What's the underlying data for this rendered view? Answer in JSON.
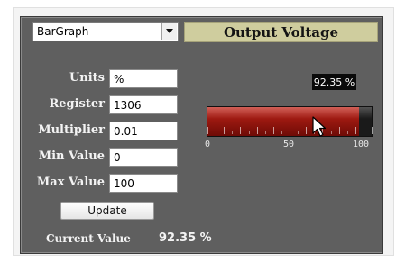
{
  "widget_type": {
    "selected": "BarGraph"
  },
  "title": "Output Voltage",
  "fields": [
    {
      "label": "Units",
      "value": "%"
    },
    {
      "label": "Register",
      "value": "1306"
    },
    {
      "label": "Multiplier",
      "value": "0.01"
    },
    {
      "label": "Min Value",
      "value": "0"
    },
    {
      "label": "Max Value",
      "value": "100"
    }
  ],
  "update_button": "Update",
  "current": {
    "label": "Current Value",
    "value": "92.35 %"
  },
  "gauge": {
    "readout": "92.35 %",
    "value": 92.35,
    "min": 0,
    "max": 100,
    "scale_labels": [
      "0",
      "50",
      "100"
    ]
  },
  "colors": {
    "panel": "#5f5f5f",
    "title_background": "#cfcd9e",
    "bar_fill": "#9a1810",
    "bar_track": "#1a1a1a"
  },
  "icons": {
    "dropdown": "chevron-down-icon",
    "cursor": "mouse-pointer-icon"
  }
}
